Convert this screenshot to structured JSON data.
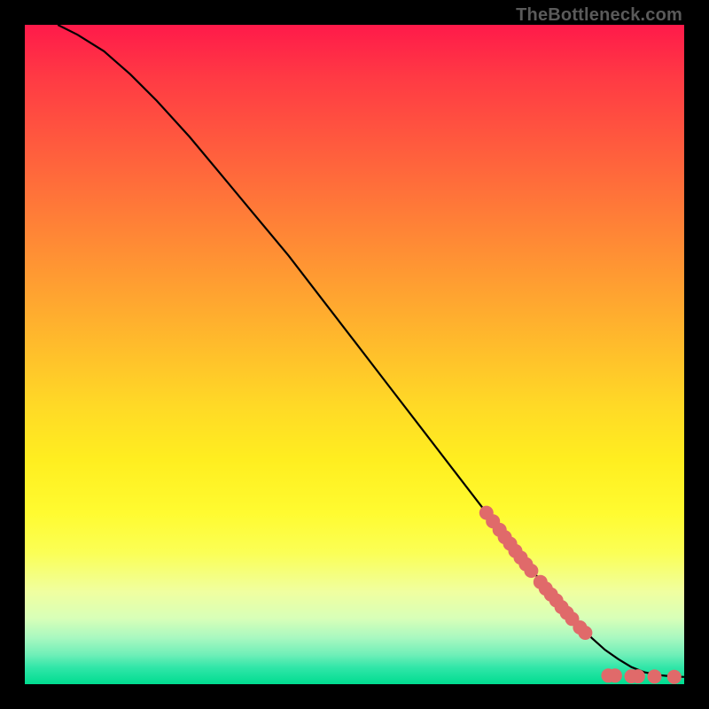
{
  "attribution": "TheBottleneck.com",
  "chart_data": {
    "type": "line",
    "title": "",
    "xlabel": "",
    "ylabel": "",
    "xlim": [
      0,
      100
    ],
    "ylim": [
      0,
      100
    ],
    "series": [
      {
        "name": "curve",
        "x": [
          5,
          8,
          12,
          16,
          20,
          25,
          30,
          35,
          40,
          45,
          50,
          55,
          60,
          65,
          70,
          73,
          75,
          78,
          80,
          82,
          84,
          86,
          88,
          90,
          92,
          94,
          96,
          98,
          100
        ],
        "y": [
          100,
          98.5,
          96,
          92.5,
          88.5,
          83,
          77,
          71,
          65,
          58.5,
          52,
          45.5,
          39,
          32.5,
          26,
          22,
          19.5,
          16,
          13.5,
          11,
          9,
          7,
          5.2,
          3.8,
          2.6,
          1.8,
          1.4,
          1.2,
          1.1
        ]
      }
    ],
    "markers": [
      {
        "x": 70.0,
        "y": 26.0
      },
      {
        "x": 71.0,
        "y": 24.7
      },
      {
        "x": 72.0,
        "y": 23.4
      },
      {
        "x": 72.8,
        "y": 22.3
      },
      {
        "x": 73.6,
        "y": 21.3
      },
      {
        "x": 74.4,
        "y": 20.2
      },
      {
        "x": 75.2,
        "y": 19.2
      },
      {
        "x": 76.0,
        "y": 18.2
      },
      {
        "x": 76.8,
        "y": 17.2
      },
      {
        "x": 78.2,
        "y": 15.5
      },
      {
        "x": 79.0,
        "y": 14.5
      },
      {
        "x": 79.8,
        "y": 13.6
      },
      {
        "x": 80.6,
        "y": 12.7
      },
      {
        "x": 81.4,
        "y": 11.7
      },
      {
        "x": 82.2,
        "y": 10.8
      },
      {
        "x": 83.0,
        "y": 9.9
      },
      {
        "x": 84.2,
        "y": 8.6
      },
      {
        "x": 85.0,
        "y": 7.8
      },
      {
        "x": 88.5,
        "y": 1.3
      },
      {
        "x": 89.5,
        "y": 1.3
      },
      {
        "x": 92.0,
        "y": 1.2
      },
      {
        "x": 93.0,
        "y": 1.2
      },
      {
        "x": 95.5,
        "y": 1.15
      },
      {
        "x": 98.5,
        "y": 1.1
      }
    ],
    "marker_color": "#e06a6a",
    "curve_color": "#000000"
  }
}
